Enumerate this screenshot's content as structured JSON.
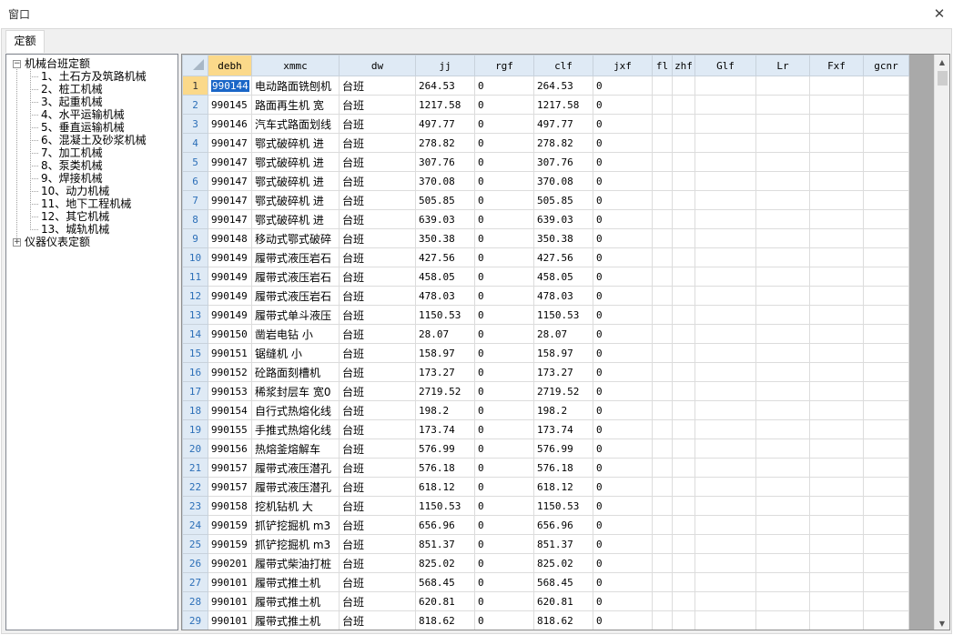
{
  "window": {
    "title": "窗口",
    "close_glyph": "✕"
  },
  "tabs": [
    {
      "label": "定额"
    }
  ],
  "tree": {
    "root_label": "机械台班定额",
    "children": [
      "1、土石方及筑路机械",
      "2、桩工机械",
      "3、起重机械",
      "4、水平运输机械",
      "5、垂直运输机械",
      "6、混凝土及砂浆机械",
      "7、加工机械",
      "8、泵类机械",
      "9、焊接机械",
      "10、动力机械",
      "11、地下工程机械",
      "12、其它机械",
      "13、城轨机械"
    ],
    "second_root_label": "仪器仪表定额"
  },
  "grid": {
    "columns": [
      "debh",
      "xmmc",
      "dw",
      "jj",
      "rgf",
      "clf",
      "jxf",
      "fl",
      "zhf",
      "Glf",
      "Lr",
      "Fxf",
      "gcnr"
    ],
    "active_column": "debh",
    "active_row": 1,
    "rows": [
      [
        "1",
        "990144",
        "电动路面铣刨机",
        "台班",
        "264.53",
        "0",
        "264.53",
        "0"
      ],
      [
        "2",
        "990145",
        "路面再生机 宽",
        "台班",
        "1217.58",
        "0",
        "1217.58",
        "0"
      ],
      [
        "3",
        "990146",
        "汽车式路面划线",
        "台班",
        "497.77",
        "0",
        "497.77",
        "0"
      ],
      [
        "4",
        "990147",
        "鄂式破碎机 进",
        "台班",
        "278.82",
        "0",
        "278.82",
        "0"
      ],
      [
        "5",
        "990147",
        "鄂式破碎机 进",
        "台班",
        "307.76",
        "0",
        "307.76",
        "0"
      ],
      [
        "6",
        "990147",
        "鄂式破碎机 进",
        "台班",
        "370.08",
        "0",
        "370.08",
        "0"
      ],
      [
        "7",
        "990147",
        "鄂式破碎机 进",
        "台班",
        "505.85",
        "0",
        "505.85",
        "0"
      ],
      [
        "8",
        "990147",
        "鄂式破碎机 进",
        "台班",
        "639.03",
        "0",
        "639.03",
        "0"
      ],
      [
        "9",
        "990148",
        "移动式鄂式破碎",
        "台班",
        "350.38",
        "0",
        "350.38",
        "0"
      ],
      [
        "10",
        "990149",
        "履带式液压岩石",
        "台班",
        "427.56",
        "0",
        "427.56",
        "0"
      ],
      [
        "11",
        "990149",
        "履带式液压岩石",
        "台班",
        "458.05",
        "0",
        "458.05",
        "0"
      ],
      [
        "12",
        "990149",
        "履带式液压岩石",
        "台班",
        "478.03",
        "0",
        "478.03",
        "0"
      ],
      [
        "13",
        "990149",
        "履带式单斗液压",
        "台班",
        "1150.53",
        "0",
        "1150.53",
        "0"
      ],
      [
        "14",
        "990150",
        "凿岩电钻 小",
        "台班",
        "28.07",
        "0",
        "28.07",
        "0"
      ],
      [
        "15",
        "990151",
        "锯缝机 小",
        "台班",
        "158.97",
        "0",
        "158.97",
        "0"
      ],
      [
        "16",
        "990152",
        "砼路面刻槽机",
        "台班",
        "173.27",
        "0",
        "173.27",
        "0"
      ],
      [
        "17",
        "990153",
        "稀浆封层车 宽0",
        "台班",
        "2719.52",
        "0",
        "2719.52",
        "0"
      ],
      [
        "18",
        "990154",
        "自行式热熔化线",
        "台班",
        "198.2",
        "0",
        "198.2",
        "0"
      ],
      [
        "19",
        "990155",
        "手推式热熔化线",
        "台班",
        "173.74",
        "0",
        "173.74",
        "0"
      ],
      [
        "20",
        "990156",
        "热熔釜熔解车",
        "台班",
        "576.99",
        "0",
        "576.99",
        "0"
      ],
      [
        "21",
        "990157",
        "履带式液压潜孔",
        "台班",
        "576.18",
        "0",
        "576.18",
        "0"
      ],
      [
        "22",
        "990157",
        "履带式液压潜孔",
        "台班",
        "618.12",
        "0",
        "618.12",
        "0"
      ],
      [
        "23",
        "990158",
        "挖机钻机 大",
        "台班",
        "1150.53",
        "0",
        "1150.53",
        "0"
      ],
      [
        "24",
        "990159",
        "抓铲挖掘机 m3",
        "台班",
        "656.96",
        "0",
        "656.96",
        "0"
      ],
      [
        "25",
        "990159",
        "抓铲挖掘机 m3",
        "台班",
        "851.37",
        "0",
        "851.37",
        "0"
      ],
      [
        "26",
        "990201",
        "履带式柴油打桩",
        "台班",
        "825.02",
        "0",
        "825.02",
        "0"
      ],
      [
        "27",
        "990101",
        "履带式推土机",
        "台班",
        "568.45",
        "0",
        "568.45",
        "0"
      ],
      [
        "28",
        "990101",
        "履带式推土机",
        "台班",
        "620.81",
        "0",
        "620.81",
        "0"
      ],
      [
        "29",
        "990101",
        "履带式推土机",
        "台班",
        "818.62",
        "0",
        "818.62",
        "0"
      ]
    ]
  },
  "icons": {
    "expander_open": "−",
    "expander_closed": "+",
    "scroll_up": "▲",
    "scroll_down": "▼"
  }
}
